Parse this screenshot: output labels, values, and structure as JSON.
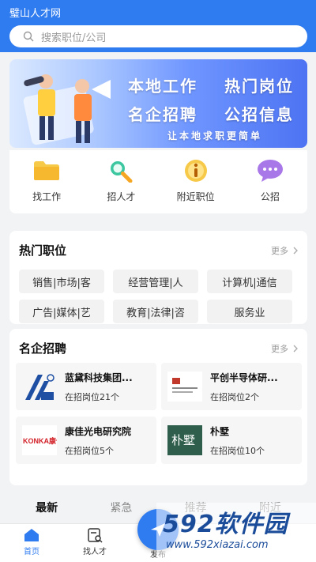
{
  "header": {
    "app_title": "璧山人才网",
    "search_placeholder": "搜索职位/公司"
  },
  "banner": {
    "line1a": "本地工作",
    "line1b": "热门岗位",
    "line2a": "名企招聘",
    "line2b": "公招信息",
    "slogan": "让本地求职更简单"
  },
  "quick": [
    {
      "label": "找工作",
      "icon": "folder-icon"
    },
    {
      "label": "招人才",
      "icon": "magnifier-icon"
    },
    {
      "label": "附近职位",
      "icon": "info-location-icon"
    },
    {
      "label": "公招",
      "icon": "chat-bubble-icon"
    }
  ],
  "hot": {
    "title": "热门职位",
    "more": "更多",
    "tags": [
      "销售|市场|客",
      "经营管理|人",
      "计算机|通信",
      "广告|媒体|艺",
      "教育|法律|咨",
      "服务业"
    ]
  },
  "brand": {
    "title": "名企招聘",
    "more": "更多",
    "companies": [
      {
        "name": "蓝黛科技集团...",
        "positions": "在招岗位21个"
      },
      {
        "name": "平创半导体研...",
        "positions": "在招岗位2个"
      },
      {
        "name": "康佳光电研究院",
        "positions": "在招岗位5个",
        "logo_text": "KONKA康佳"
      },
      {
        "name": "朴墅",
        "positions": "在招岗位10个",
        "logo_text": "朴墅"
      }
    ]
  },
  "tabs": [
    "最新",
    "紧急",
    "推荐",
    "附近"
  ],
  "bottom_nav": [
    {
      "label": "首页"
    },
    {
      "label": "找人才"
    },
    {
      "label": "发布"
    }
  ],
  "watermark": {
    "brand": "592软件园",
    "url": "www.592xiazai.com"
  },
  "colors": {
    "primary": "#2f7bf0",
    "background": "#f2f3f5"
  }
}
